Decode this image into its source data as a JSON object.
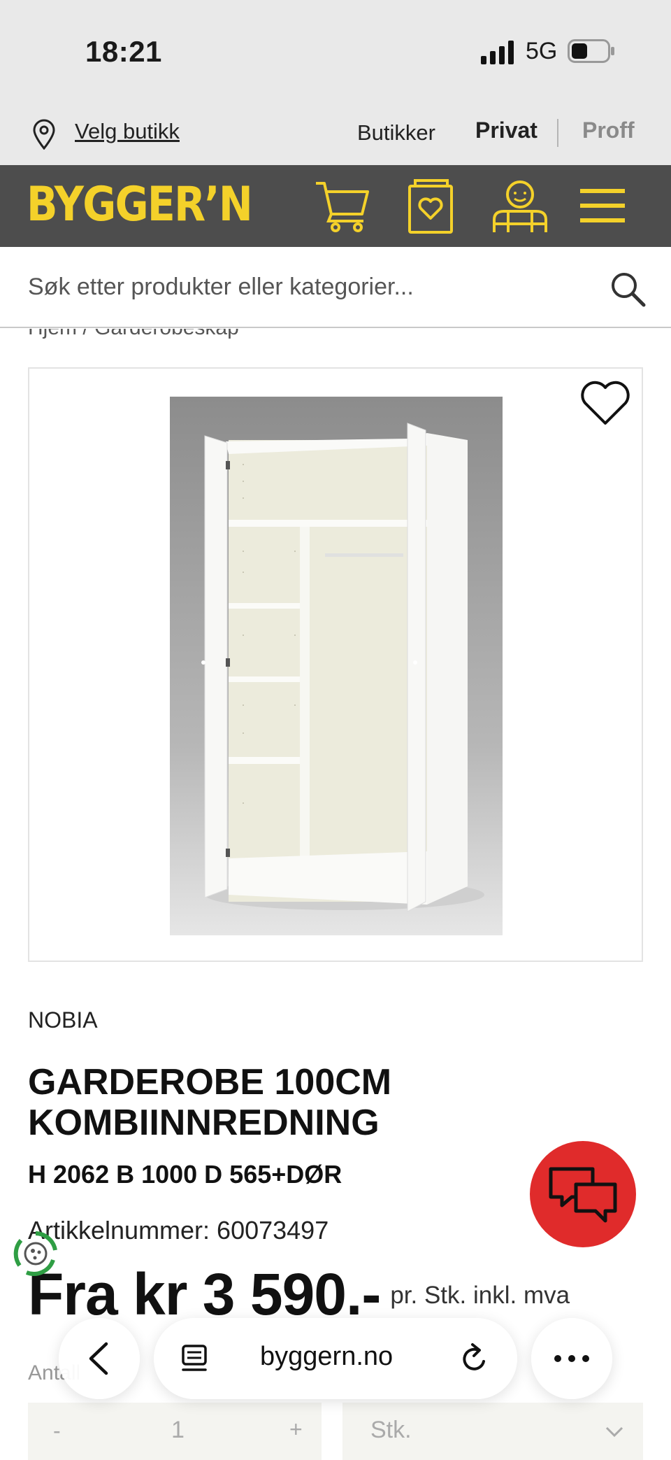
{
  "status_bar": {
    "time": "18:21",
    "network": "5G"
  },
  "utility_bar": {
    "store_link": "Velg butikk",
    "stores": "Butikker",
    "private": "Privat",
    "pro": "Proff"
  },
  "header": {
    "logo": "BYGGER’N",
    "brand_color": "#f4d12a",
    "background_color": "#4d4d4d",
    "icons": [
      "cart-icon",
      "wishlist-icon",
      "user-icon",
      "menu-icon"
    ]
  },
  "search": {
    "placeholder": "Søk etter produkter eller kategorier..."
  },
  "breadcrumb": "Hjem  /  Garderobeskap",
  "product": {
    "brand": "NOBIA",
    "title": "GARDEROBE 100CM KOMBIINNREDNING",
    "dimensions": "H 2062 B 1000 D 565+DØR",
    "article_number": "Artikkelnummer: 60073497",
    "price": "Fra kr 3 590.-",
    "price_unit": "pr. Stk. inkl. mva"
  },
  "purchase": {
    "quantity_label": "Antall",
    "quantity_minus": "-",
    "quantity_value": "1",
    "quantity_plus": "+",
    "unit": "Stk."
  },
  "chat": {
    "color": "#e02b2b"
  },
  "browser": {
    "url": "byggern.no"
  }
}
